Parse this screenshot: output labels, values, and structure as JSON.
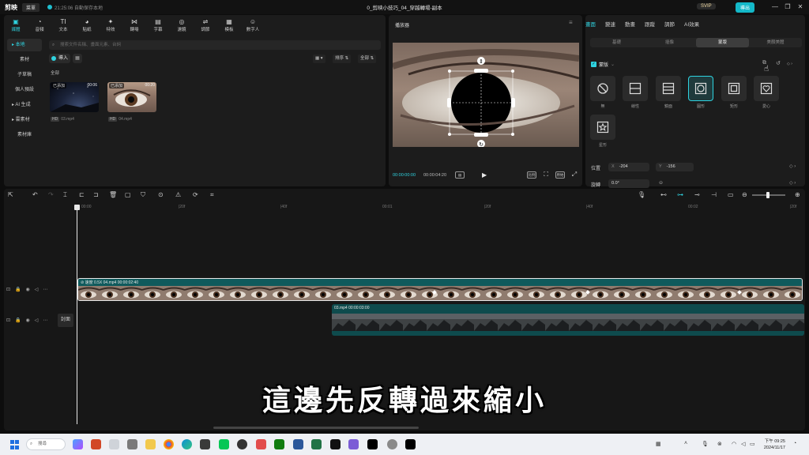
{
  "app": {
    "logo_text": "剪映",
    "menu_label": "菜單",
    "autosave_text": "21:25:06 自動保存本地",
    "project_title": "0_剪映小技巧_04_穿越轉場-副本",
    "vip_label": "SVIP",
    "export_label": "導出",
    "window_buttons": [
      "—",
      "❐",
      "✕"
    ]
  },
  "media_toolbar": {
    "items": [
      {
        "label": "媒體",
        "icon": "media-icon",
        "glyph": "▣"
      },
      {
        "label": "音頻",
        "icon": "audio-icon",
        "glyph": "◔"
      },
      {
        "label": "文本",
        "icon": "text-icon",
        "glyph": "TI"
      },
      {
        "label": "貼紙",
        "icon": "sticker-icon",
        "glyph": "◕"
      },
      {
        "label": "特效",
        "icon": "effects-icon",
        "glyph": "✦"
      },
      {
        "label": "轉場",
        "icon": "transition-icon",
        "glyph": "⋈"
      },
      {
        "label": "字幕",
        "icon": "subtitle-icon",
        "glyph": "▤"
      },
      {
        "label": "濾鏡",
        "icon": "filter-icon",
        "glyph": "◎"
      },
      {
        "label": "調節",
        "icon": "adjust-icon",
        "glyph": "⇌"
      },
      {
        "label": "模板",
        "icon": "template-icon",
        "glyph": "▦"
      },
      {
        "label": "數字人",
        "icon": "avatar-icon",
        "glyph": "☺"
      }
    ]
  },
  "left_nav": {
    "items": [
      "▸ 本地",
      "素材",
      "子草稿",
      "個人預設",
      "▸ AI 生成",
      "▸ 雲素材",
      "素材庫"
    ]
  },
  "media": {
    "search_placeholder": "搜索文件名稱、畫面元素、台詞",
    "import_label": "導入",
    "sort_label": "排序",
    "filter_label": "全部",
    "all_label": "全部",
    "clips": [
      {
        "badge": "已添加",
        "duration": "00:06",
        "name": "03.mp4"
      },
      {
        "badge": "已添加",
        "duration": "00:20",
        "name": "04.mp4"
      }
    ]
  },
  "player": {
    "title": "播放器",
    "current_time": "00:00:00:00",
    "total_time": "00:00:04:20",
    "controls": [
      "比例",
      "⛶",
      "原始",
      "⤢"
    ]
  },
  "inspector": {
    "tabs": [
      "畫面",
      "變速",
      "動畫",
      "跟蹤",
      "調節",
      "AI效果"
    ],
    "subtabs": [
      "基礎",
      "摳像",
      "蒙版",
      "美顏美體"
    ],
    "mask_title": "蒙版",
    "tooltip": "反轉",
    "masks": [
      {
        "label": "無",
        "icon": "none-mask-icon"
      },
      {
        "label": "線性",
        "icon": "linear-mask-icon"
      },
      {
        "label": "鏡面",
        "icon": "mirror-mask-icon"
      },
      {
        "label": "圓形",
        "icon": "circle-mask-icon"
      },
      {
        "label": "矩形",
        "icon": "rectangle-mask-icon"
      },
      {
        "label": "愛心",
        "icon": "heart-mask-icon"
      },
      {
        "label": "星形",
        "icon": "star-mask-icon"
      }
    ],
    "position_label": "位置",
    "pos_x_axis": "X",
    "pos_x": "-204",
    "pos_y_axis": "Y",
    "pos_y": "-156",
    "rotate_label": "旋轉",
    "rotate_value": "0.0°"
  },
  "timeline": {
    "ruler": [
      "00:00",
      "|20f",
      "|40f",
      "00:01",
      "|20f",
      "|40f",
      "00:02",
      "|20f"
    ],
    "cover_label": "封面",
    "main_clip_label": "⊘ 速度 0.5X  04.mp4  00:00:02:40",
    "overlay_clip_label": "03.mp4  00:00:03:00"
  },
  "subtitle": "這邊先反轉過來縮小",
  "taskbar": {
    "search_label": "搜尋",
    "clock_time": "下午 09:25",
    "clock_date": "2024/11/17"
  },
  "colors": {
    "accent": "#2fd3e0",
    "clip_main": "#0f5a5c",
    "clip_overlay": "#0e4b4d"
  }
}
